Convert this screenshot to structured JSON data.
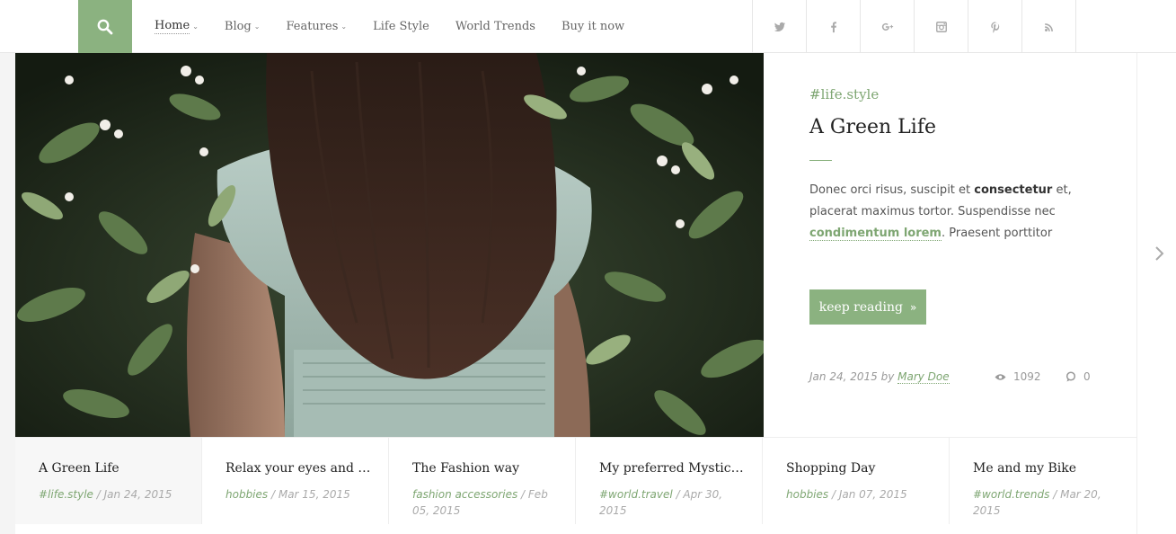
{
  "nav": {
    "items": [
      {
        "label": "Home",
        "has_dropdown": true,
        "active": true
      },
      {
        "label": "Blog",
        "has_dropdown": true,
        "active": false
      },
      {
        "label": "Features",
        "has_dropdown": true,
        "active": false
      },
      {
        "label": "Life Style",
        "has_dropdown": false,
        "active": false
      },
      {
        "label": "World Trends",
        "has_dropdown": false,
        "active": false
      },
      {
        "label": "Buy it now",
        "has_dropdown": false,
        "active": false
      }
    ]
  },
  "social": [
    "twitter-icon",
    "facebook-icon",
    "google-plus-icon",
    "instagram-icon",
    "pinterest-icon",
    "rss-icon"
  ],
  "featured": {
    "tag": "#life.style",
    "title": "A Green Life",
    "excerpt_parts": [
      "Donec orci risus, suscipit et ",
      "consectetur",
      " et, placerat maximus tortor. Suspendisse nec ",
      "condimentum lorem",
      ". Praesent porttitor"
    ],
    "button_label": "keep reading",
    "date": "Jan 24, 2015",
    "by": "by",
    "author": "Mary Doe",
    "views": "1092",
    "comments": "0"
  },
  "strip": [
    {
      "title": "A Green Life",
      "category": "#life.style",
      "date": "/ Jan 24, 2015",
      "active": true
    },
    {
      "title": "Relax your eyes and t...",
      "category": "hobbies",
      "date": "/ Mar 15, 2015",
      "active": false
    },
    {
      "title": "The Fashion way",
      "category": "fashion accessories",
      "date": "/ Feb 05, 2015",
      "active": false
    },
    {
      "title": "My preferred Mystic ...",
      "category": "#world.travel",
      "date": "/ Apr 30, 2015",
      "active": false
    },
    {
      "title": "Shopping Day",
      "category": "hobbies",
      "date": "/ Jan 07, 2015",
      "active": false
    },
    {
      "title": "Me and my Bike",
      "category": "#world.trends",
      "date": "/ Mar 20, 2015",
      "active": false
    }
  ],
  "colors": {
    "accent": "#8bb280",
    "accent_text": "#7ea672"
  }
}
